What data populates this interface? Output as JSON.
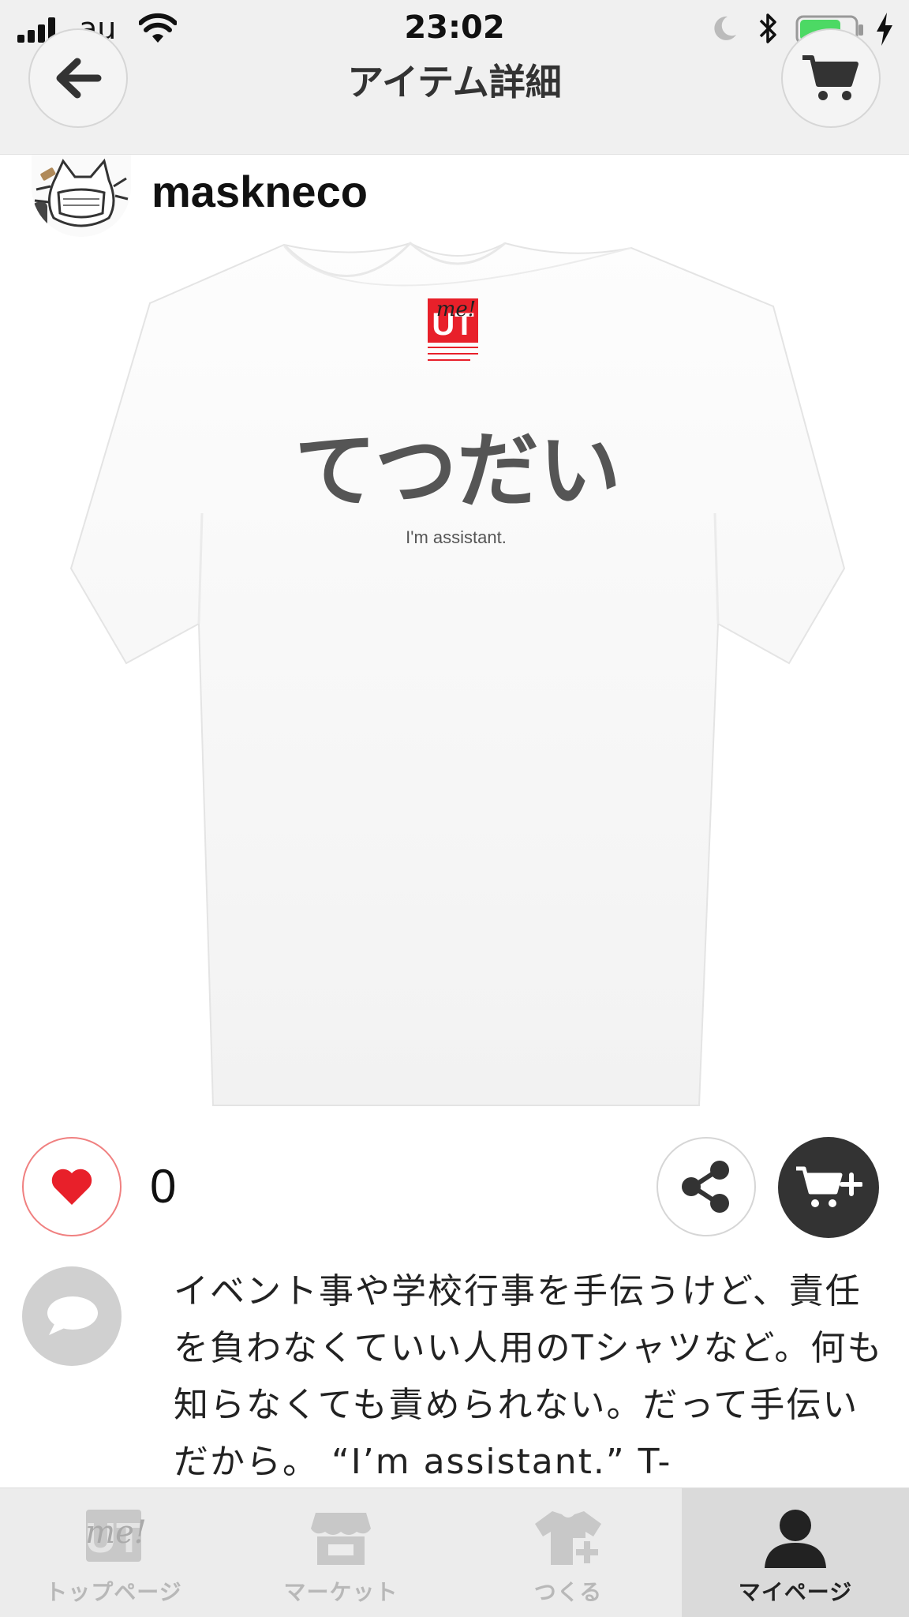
{
  "status_bar": {
    "carrier": "au",
    "time": "23:02",
    "battery_level": 0.75
  },
  "nav": {
    "title": "アイテム詳細",
    "back_icon": "back-arrow-icon",
    "cart_icon": "cart-icon"
  },
  "user": {
    "name": "maskneco",
    "avatar_icon": "cat-mask-avatar"
  },
  "product": {
    "print_main": "てつだい",
    "print_sub": "I'm assistant.",
    "tag_logo": "UT",
    "tag_me": "me!"
  },
  "actions": {
    "like_count": "0",
    "like_icon": "heart-icon",
    "share_icon": "share-icon",
    "add_to_cart_icon": "cart-plus-icon",
    "accent_color": "#e8202a"
  },
  "description": {
    "comment_icon": "speech-bubble-icon",
    "text": "イベント事や学校行事を手伝うけど、責任を負わなくていい人用のTシャツなど。何も知らなくても責められない。だって手伝いだから。 “I’m assistant.” T-"
  },
  "tabbar": {
    "active_tab": "マイページ",
    "tabs": [
      {
        "label": "トップページ",
        "icon": "ut-me-logo-icon"
      },
      {
        "label": "マーケット",
        "icon": "store-icon"
      },
      {
        "label": "つくる",
        "icon": "shirt-plus-icon"
      },
      {
        "label": "マイページ",
        "icon": "person-icon"
      }
    ]
  }
}
